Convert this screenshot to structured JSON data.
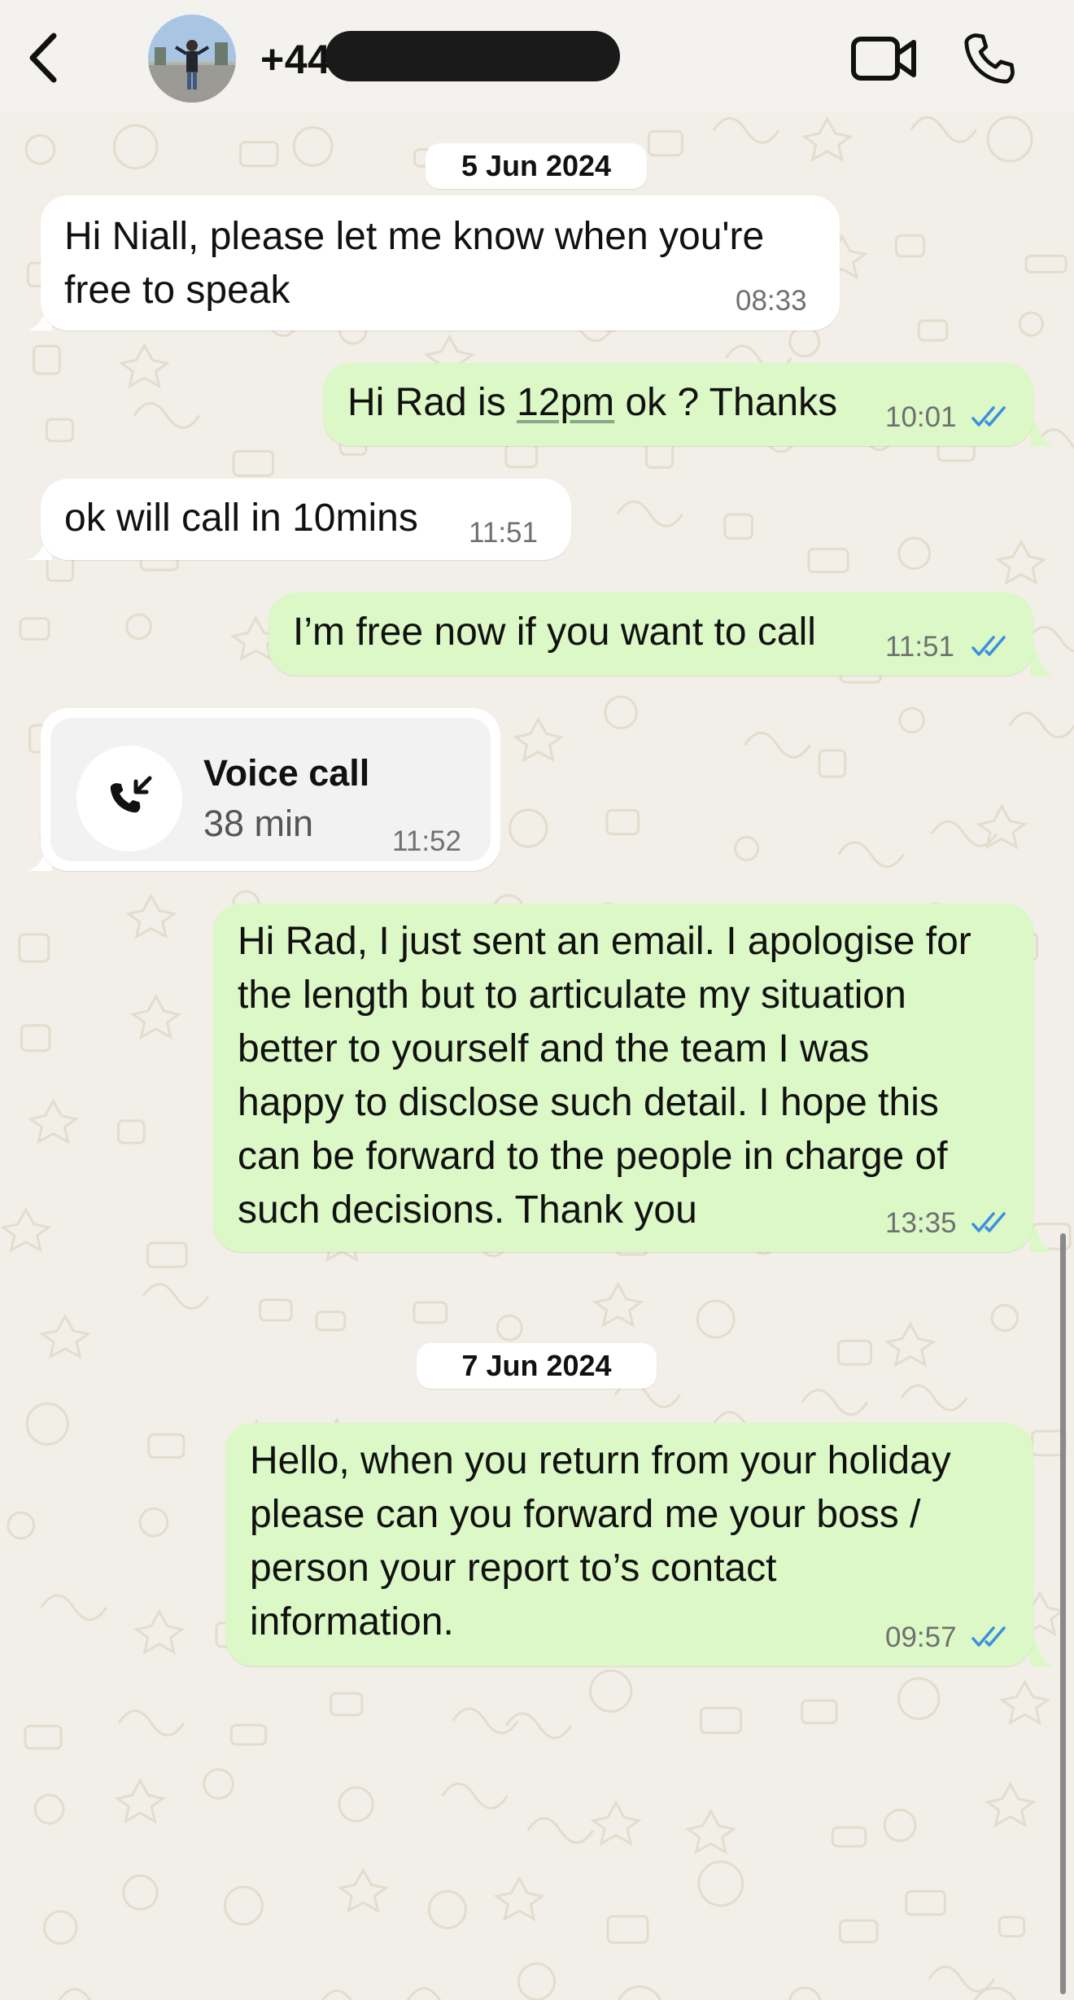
{
  "header": {
    "contact_number": "+44",
    "back_icon": "chevron-left-icon",
    "video_icon": "video-camera-icon",
    "call_icon": "phone-icon"
  },
  "dates": [
    "5 Jun 2024",
    "7 Jun 2024"
  ],
  "messages": [
    {
      "direction": "incoming",
      "text": "Hi Niall, please let me know when you're\nfree to speak",
      "time": "08:33"
    },
    {
      "direction": "outgoing",
      "text_before": "Hi Rad is ",
      "link_text": "12pm",
      "text_after": " ok ? Thanks",
      "time": "10:01",
      "status": "read"
    },
    {
      "direction": "incoming",
      "text": "ok will call in 10mins",
      "time": "11:51"
    },
    {
      "direction": "outgoing",
      "text": "I’m free now if you want to call",
      "time": "11:51",
      "status": "read"
    },
    {
      "direction": "incoming",
      "type": "voice_call",
      "title": "Voice call",
      "duration": "38 min",
      "time": "11:52",
      "icon": "incoming-call-icon"
    },
    {
      "direction": "outgoing",
      "text": "Hi Rad, I just sent an email. I apologise for\nthe length but to articulate my situation\nbetter to yourself and the team I was\nhappy to disclose such detail. I hope this\ncan be forward to the people in charge of\nsuch decisions. Thank you",
      "time": "13:35",
      "status": "read"
    },
    {
      "direction": "outgoing",
      "text": "Hello, when you return from your holiday\nplease can you forward me your boss /\nperson your report to’s contact\ninformation.",
      "time": "09:57",
      "status": "read"
    }
  ],
  "colors": {
    "background": "#f2efe8",
    "incoming_bubble": "#ffffff",
    "outgoing_bubble": "#dbf8c6",
    "read_ticks": "#3b8fe0",
    "doodle": "#e4dccd"
  }
}
